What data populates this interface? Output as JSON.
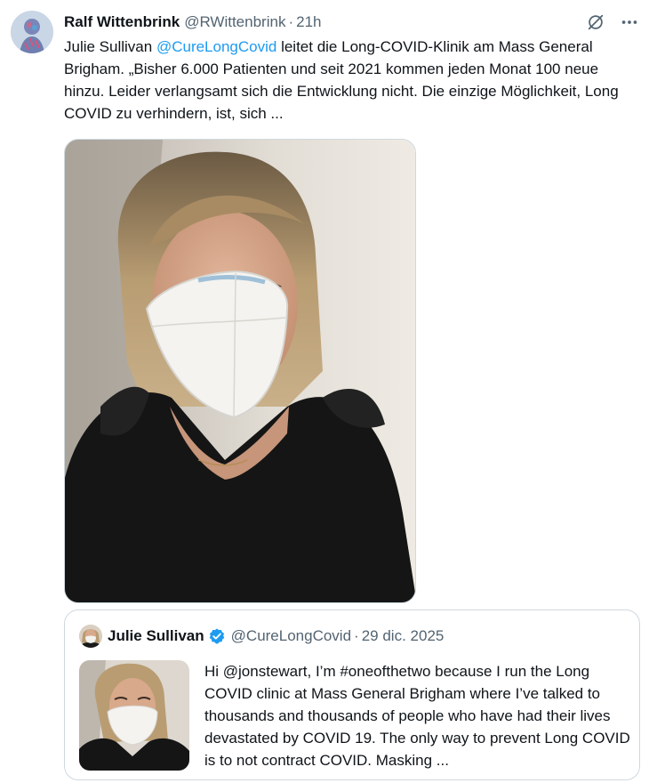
{
  "tweet": {
    "author_name": "Ralf Wittenbrink",
    "author_handle": "@RWittenbrink",
    "separator": "·",
    "time": "21h",
    "text_before_mention": "Julie Sullivan ",
    "mention": "@CureLongCovid",
    "text_after_mention": " leitet die Long-COVID-Klinik am Mass General Brigham. „Bisher 6.000 Patienten und seit 2021 kommen jeden Monat 100 neue hinzu. Leider verlangsamt sich die Entwicklung nicht. Die einzige Möglichkeit, Long COVID zu verhindern, ist, sich ..."
  },
  "icons": {
    "grok": "grok-icon",
    "more": "more-icon",
    "verified": "verified-badge-icon"
  },
  "quote": {
    "author_name": "Julie Sullivan",
    "author_handle": "@CureLongCovid",
    "separator": "·",
    "date": "29 dic. 2025",
    "text": "Hi @jonstewart, I’m  #oneofthetwo because I run the Long COVID clinic at Mass General Brigham where I’ve talked to thousands and thousands of people who have had their lives devastated by COVID 19. The only way to prevent Long COVID is to not contract COVID. Masking ..."
  },
  "colors": {
    "accent": "#1d9bf0",
    "secondary_text": "#536471",
    "border": "#cfd9de"
  }
}
